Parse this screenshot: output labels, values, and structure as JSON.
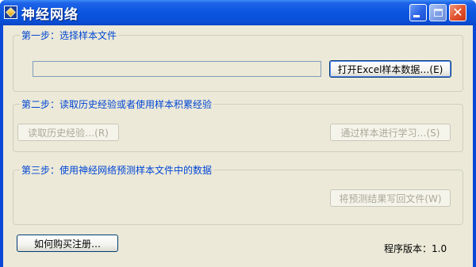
{
  "window": {
    "title": "神经网络",
    "min_icon": "minimize-icon",
    "max_icon": "maximize-icon",
    "close_icon": "close-icon"
  },
  "step1": {
    "label": "第一步：选择样本文件",
    "file_path": "",
    "open_button": "打开Excel样本数据…(E)"
  },
  "step2": {
    "label": "第二步：读取历史经验或者使用样本积累经验",
    "read_button": "读取历史经验…(R)",
    "learn_button": "通过样本进行学习…(S)"
  },
  "step3": {
    "label": "第三步：使用神经网络预测样本文件中的数据",
    "write_button": "将预测结果写回文件(W)"
  },
  "footer": {
    "register_button": "如何购买注册…",
    "version": "程序版本：1.0"
  },
  "colors": {
    "title_bar": "#0a55e0",
    "client_bg": "#ece9d8",
    "group_label": "#0046d5",
    "disabled_text": "#aca899"
  }
}
